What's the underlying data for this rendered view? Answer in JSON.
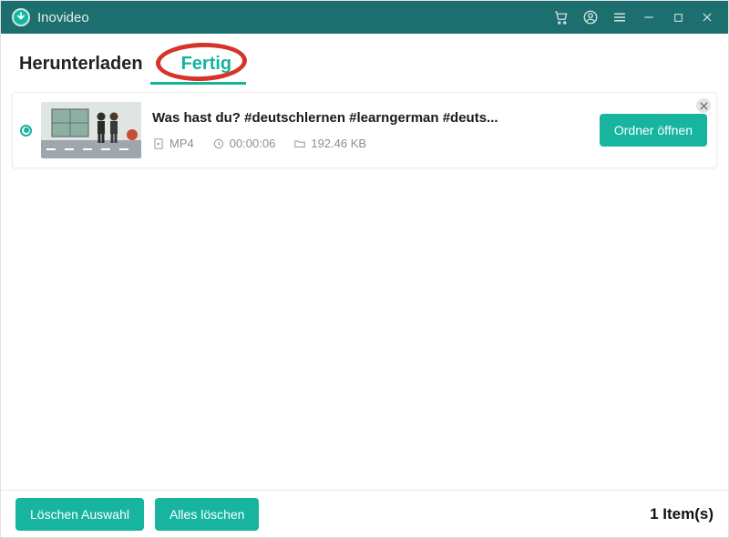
{
  "app": {
    "title": "Inovideo"
  },
  "tabs": {
    "downloading": "Herunterladen",
    "done": "Fertig"
  },
  "items": [
    {
      "title": "Was hast du? #deutschlernen #learngerman #deuts...",
      "format": "MP4",
      "duration": "00:00:06",
      "size": "192.46 KB",
      "open_label": "Ordner öffnen"
    }
  ],
  "footer": {
    "delete_selection": "Löschen Auswahl",
    "delete_all": "Alles löschen",
    "count_label": "1 Item(s)"
  }
}
